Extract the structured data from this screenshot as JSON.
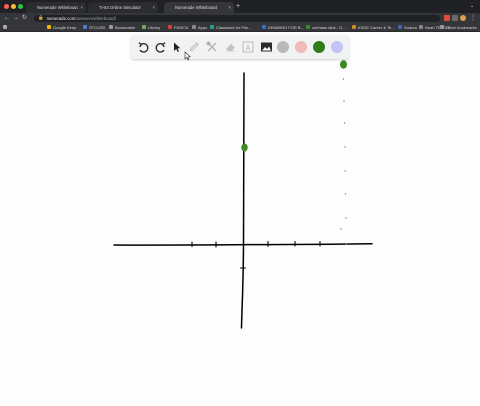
{
  "browser": {
    "tabs": [
      {
        "title": "Numerade Whiteboard",
        "active": false
      },
      {
        "title": "TI-84 Online Simulator",
        "active": false
      },
      {
        "title": "Numerade Whiteboard",
        "active": true
      }
    ],
    "address": {
      "domain": "numerade.com",
      "path": "/answers/whiteboard/"
    },
    "bookmarks": [
      {
        "label": "Google Keep"
      },
      {
        "label": "STCUSD"
      },
      {
        "label": "Bookmarks"
      },
      {
        "label": "Library"
      },
      {
        "label": "FIDECK"
      },
      {
        "label": "Apps"
      },
      {
        "label": "Classwork for Pilo..."
      },
      {
        "label": "DRAWING FOR B..."
      },
      {
        "label": "zoehaas labs - G..."
      },
      {
        "label": "KSDE Career & Te..."
      },
      {
        "label": "Sudora"
      },
      {
        "label": "Noah TEACH"
      },
      {
        "label": "Other bookmarks"
      }
    ]
  },
  "toolbar": {
    "tools": [
      {
        "icon": "undo-icon"
      },
      {
        "icon": "redo-icon"
      },
      {
        "icon": "select-arrow-icon"
      },
      {
        "icon": "pen-icon"
      },
      {
        "icon": "tools-icon"
      },
      {
        "icon": "eraser-icon"
      },
      {
        "icon": "text-icon",
        "glyph": "A"
      },
      {
        "icon": "image-icon"
      }
    ],
    "colors": [
      "#b9b9b9",
      "#f2b9b9",
      "#2e7d1a",
      "#c3c3f6"
    ],
    "active_color": "#2e7d1a"
  },
  "drawing": {
    "ink_color": "#000000",
    "dot_color": "#3a8a20"
  }
}
